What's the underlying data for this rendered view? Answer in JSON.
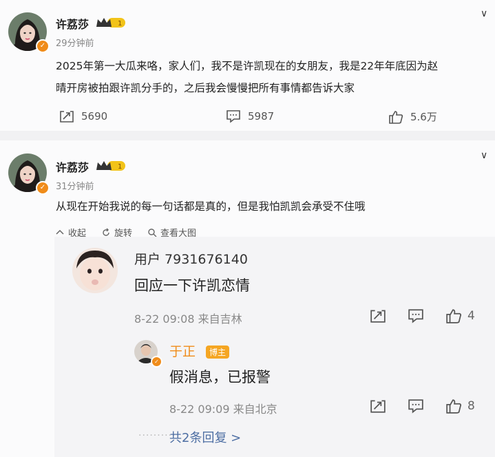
{
  "post1": {
    "author": "许荔莎",
    "level": "1",
    "time": "29分钟前",
    "content_line1": "2025年第一大瓜来咯，家人们，我不是许凯现在的女朋友，我是22年年底因为赵",
    "content_line2": "晴开房被拍跟许凯分手的，之后我会慢慢把所有事情都告诉大家",
    "repost_count": "5690",
    "comment_count": "5987",
    "like_count": "5.6万"
  },
  "post2": {
    "author": "许荔莎",
    "level": "1",
    "time": "31分钟前",
    "content": "从现在开始我说的每一句话都是真的，但是我怕凯凯会承受不住哦",
    "toolbar": {
      "collapse": "收起",
      "rotate": "旋转",
      "view_large": "查看大图"
    }
  },
  "comment": {
    "user": "用户 7931676140",
    "text": "回应一下许凯恋情",
    "meta": "8-22 09:08  来自吉林",
    "like_count": "4"
  },
  "reply": {
    "user": "于正",
    "badge": "博主",
    "text": "假消息，已报警",
    "meta": "8-22 09:09  来自北京",
    "like_count": "8"
  },
  "more_replies": "共2条回复 >",
  "icons": {
    "verified": "verified-badge-icon",
    "crown": "crown-icon",
    "chevron": "chevron-down-icon",
    "repost": "repost-icon",
    "comment": "comment-icon",
    "like": "thumbs-up-icon"
  },
  "colors": {
    "verified": "#f08c1a",
    "level": "#f2c318",
    "link": "#4d6ea3",
    "blogger": "#f5a623"
  }
}
